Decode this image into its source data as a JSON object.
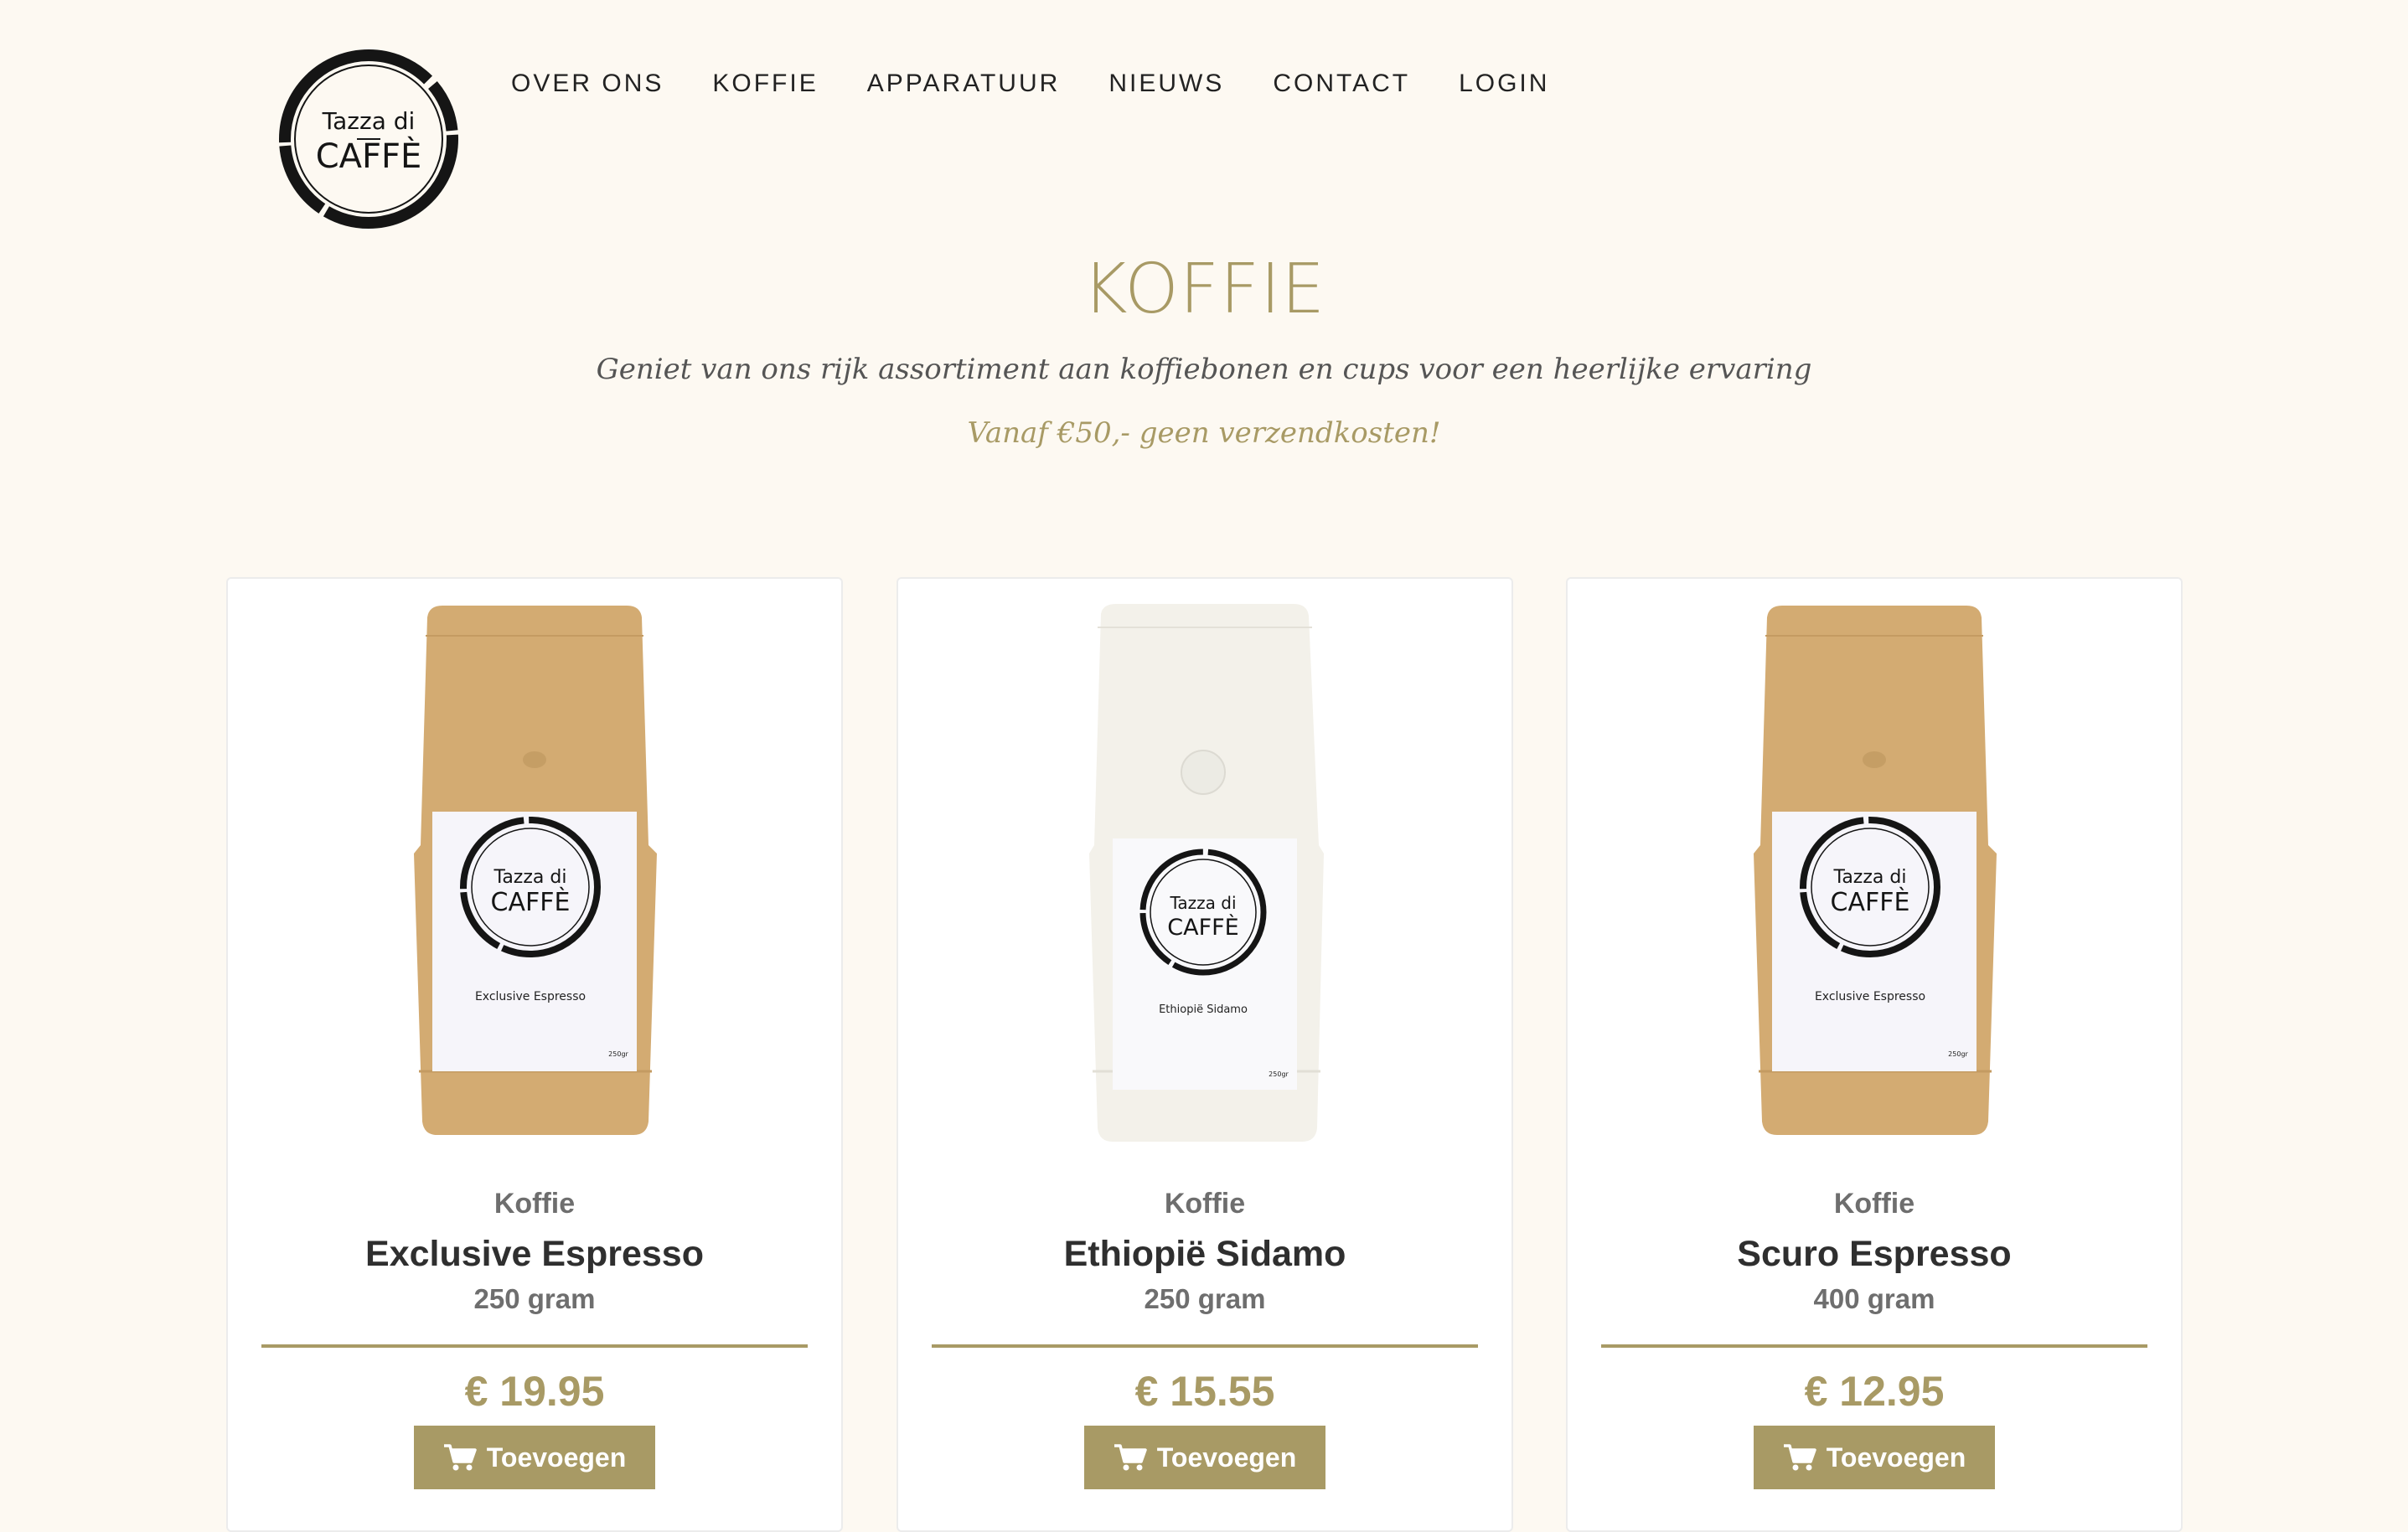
{
  "brand": {
    "logo_text_top": "Tazza di",
    "logo_text_bottom": "CAFFÈ"
  },
  "nav": {
    "items": [
      {
        "label": "OVER ONS"
      },
      {
        "label": "KOFFIE"
      },
      {
        "label": "APPARATUUR"
      },
      {
        "label": "NIEUWS"
      },
      {
        "label": "CONTACT"
      },
      {
        "label": "LOGIN"
      }
    ]
  },
  "hero": {
    "title": "KOFFIE",
    "subtitle": "Geniet van ons rijk assortiment aan koffiebonen en cups voor een heerlijke ervaring",
    "note": "Vanaf €50,- geen verzendkosten!"
  },
  "colors": {
    "accent": "#a89a65",
    "background": "#fdf9f2",
    "kraft_bag": "#d3ab72",
    "white_bag": "#f3f1ea"
  },
  "products": [
    {
      "category": "Koffie",
      "name": "Exclusive Espresso",
      "weight": "250 gram",
      "price": "€ 19.95",
      "button_label": "Toevoegen",
      "bag_color": "kraft",
      "label_text": "Exclusive Espresso",
      "label_weight": "250gr"
    },
    {
      "category": "Koffie",
      "name": "Ethiopië Sidamo",
      "weight": "250 gram",
      "price": "€ 15.55",
      "button_label": "Toevoegen",
      "bag_color": "white",
      "label_text": "Ethiopië Sidamo",
      "label_weight": "250gr"
    },
    {
      "category": "Koffie",
      "name": "Scuro Espresso",
      "weight": "400 gram",
      "price": "€ 12.95",
      "button_label": "Toevoegen",
      "bag_color": "kraft",
      "label_text": "Exclusive Espresso",
      "label_weight": "250gr"
    }
  ],
  "icons": {
    "cart": "shopping-cart-icon",
    "logo": "coffee-ring-logo"
  }
}
